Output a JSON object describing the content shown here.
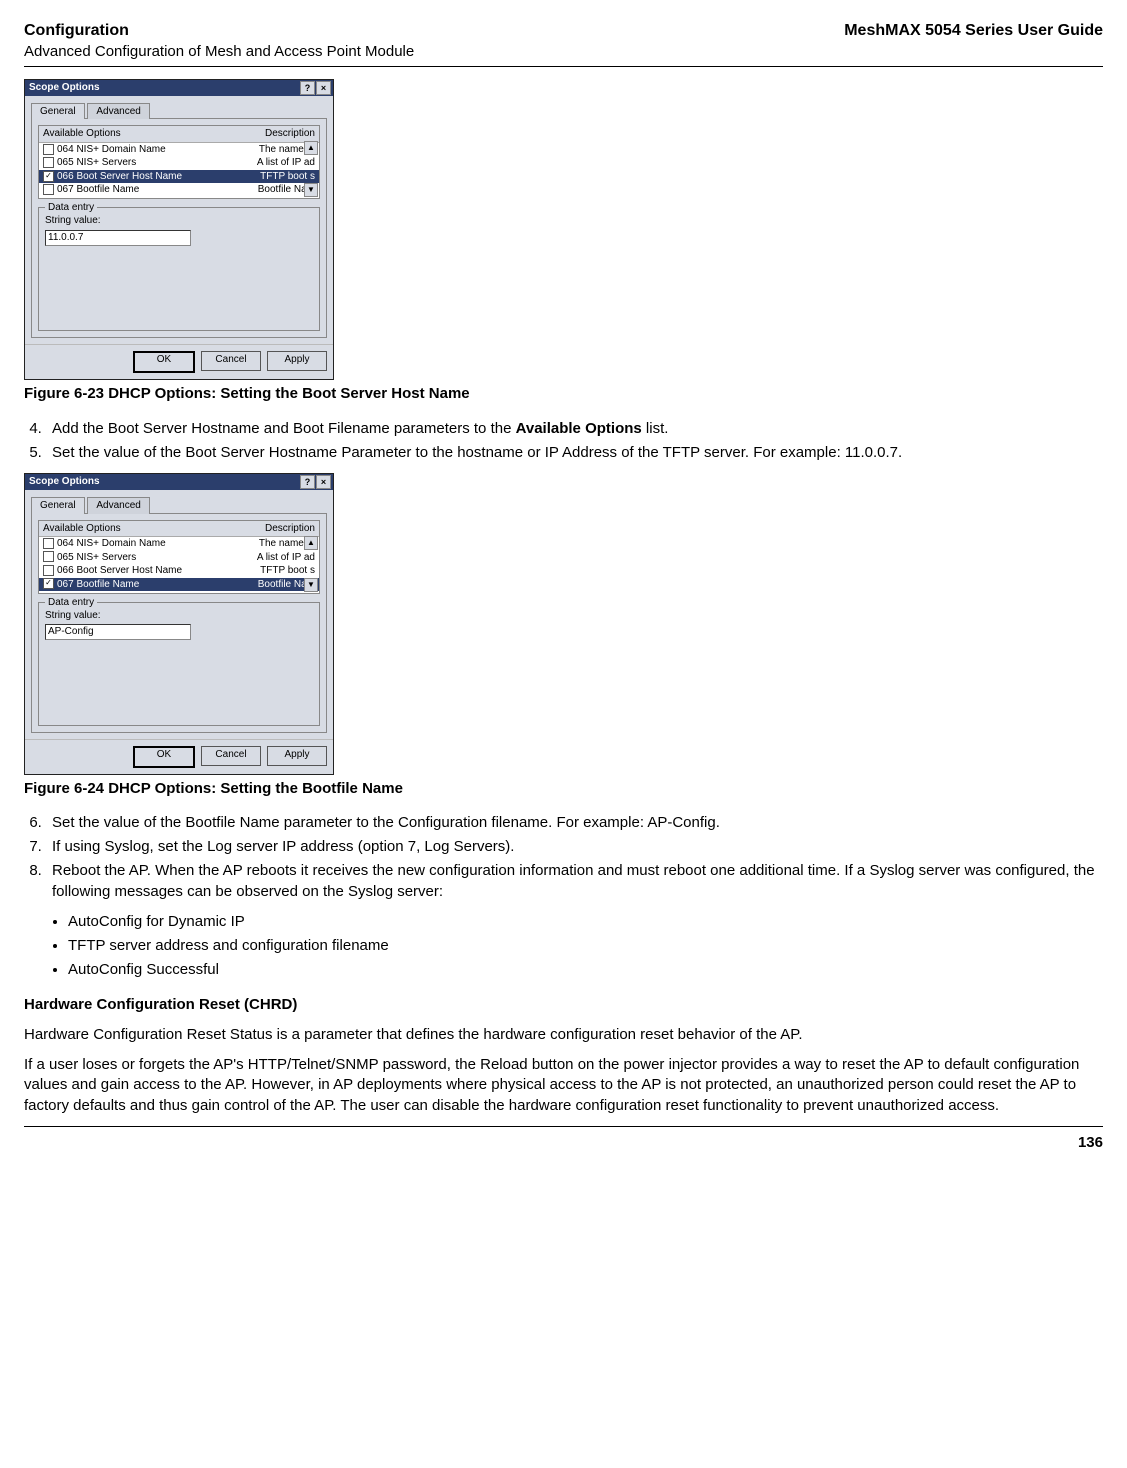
{
  "header": {
    "title": "Configuration",
    "subtitle": "Advanced Configuration of Mesh and Access Point Module",
    "right": "MeshMAX 5054 Series User Guide"
  },
  "dialog1": {
    "title": "Scope Options",
    "help_btn": "?",
    "close_btn": "×",
    "tab_general": "General",
    "tab_advanced": "Advanced",
    "col_options": "Available Options",
    "col_desc": "Description",
    "rows": [
      {
        "checked": false,
        "label": "064 NIS+ Domain Name",
        "desc": "The name of"
      },
      {
        "checked": false,
        "label": "065 NIS+ Servers",
        "desc": "A list of IP ad"
      },
      {
        "checked": true,
        "label": "066 Boot Server Host Name",
        "desc": "TFTP boot s",
        "selected": true
      },
      {
        "checked": false,
        "label": "067 Bootfile Name",
        "desc": "Bootfile Nam"
      }
    ],
    "fieldset_label": "Data entry",
    "string_label": "String value:",
    "string_value": "11.0.0.7",
    "btn_ok": "OK",
    "btn_cancel": "Cancel",
    "btn_apply": "Apply"
  },
  "caption1": "Figure 6-23 DHCP Options: Setting the Boot Server Host Name",
  "list1": {
    "start": 4,
    "items": [
      "Add the Boot Server Hostname and Boot Filename parameters to the ",
      "Set the value of the Boot Server Hostname Parameter to the hostname or IP Address of the TFTP server. For example: 11.0.0.7."
    ],
    "bold_in_4": "Available Options",
    "after_bold_4": " list."
  },
  "dialog2": {
    "title": "Scope Options",
    "help_btn": "?",
    "close_btn": "×",
    "tab_general": "General",
    "tab_advanced": "Advanced",
    "col_options": "Available Options",
    "col_desc": "Description",
    "rows": [
      {
        "checked": false,
        "label": "064 NIS+ Domain Name",
        "desc": "The name of"
      },
      {
        "checked": false,
        "label": "065 NIS+ Servers",
        "desc": "A list of IP ad"
      },
      {
        "checked": false,
        "label": "066 Boot Server Host Name",
        "desc": "TFTP boot s"
      },
      {
        "checked": true,
        "label": "067 Bootfile Name",
        "desc": "Bootfile Nam",
        "selected": true
      }
    ],
    "fieldset_label": "Data entry",
    "string_label": "String value:",
    "string_value": "AP-Config",
    "btn_ok": "OK",
    "btn_cancel": "Cancel",
    "btn_apply": "Apply"
  },
  "caption2": "Figure 6-24 DHCP Options: Setting the Bootfile Name",
  "list2": {
    "start": 6,
    "items": [
      "Set the value of the Bootfile Name parameter to the Configuration filename. For example: AP-Config.",
      "If using Syslog, set the Log server IP address (option 7, Log Servers).",
      "Reboot the AP. When the AP reboots it receives the new configuration information and must reboot one additional time. If a Syslog server was configured, the following messages can be observed on the Syslog server:"
    ]
  },
  "bullets": [
    "AutoConfig for Dynamic IP",
    "TFTP server address and configuration filename",
    "AutoConfig Successful"
  ],
  "section": {
    "title": "Hardware Configuration Reset (CHRD)",
    "p1": "Hardware Configuration Reset Status is a parameter that defines the hardware configuration reset behavior of the AP.",
    "p2": "If a user loses or forgets the AP's HTTP/Telnet/SNMP password, the Reload button on the power injector provides a way to reset the AP to default configuration values and gain access to the AP. However, in AP deployments where physical access to the AP is not protected, an unauthorized person could reset the AP to factory defaults and thus gain control of the AP. The user can disable the hardware configuration reset functionality to prevent unauthorized access."
  },
  "page_number": "136"
}
